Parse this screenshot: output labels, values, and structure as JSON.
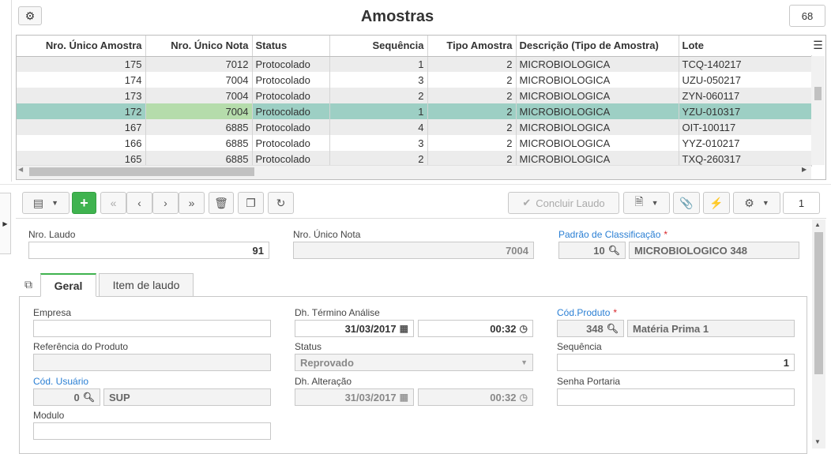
{
  "header": {
    "title": "Amostras",
    "record_count": "68"
  },
  "grid": {
    "columns": [
      "Nro. Único Amostra",
      "Nro. Único Nota",
      "Status",
      "Sequência",
      "Tipo Amostra",
      "Descrição (Tipo de Amostra)",
      "Lote"
    ],
    "rows": [
      {
        "amostra": "175",
        "nota": "7012",
        "status": "Protocolado",
        "seq": "1",
        "tipo": "2",
        "desc": "MICROBIOLOGICA",
        "lote": "TCQ-140217"
      },
      {
        "amostra": "174",
        "nota": "7004",
        "status": "Protocolado",
        "seq": "3",
        "tipo": "2",
        "desc": "MICROBIOLOGICA",
        "lote": "UZU-050217"
      },
      {
        "amostra": "173",
        "nota": "7004",
        "status": "Protocolado",
        "seq": "2",
        "tipo": "2",
        "desc": "MICROBIOLOGICA",
        "lote": "ZYN-060117"
      },
      {
        "amostra": "172",
        "nota": "7004",
        "status": "Protocolado",
        "seq": "1",
        "tipo": "2",
        "desc": "MICROBIOLOGICA",
        "lote": "YZU-010317"
      },
      {
        "amostra": "167",
        "nota": "6885",
        "status": "Protocolado",
        "seq": "4",
        "tipo": "2",
        "desc": "MICROBIOLOGICA",
        "lote": "OIT-100117"
      },
      {
        "amostra": "166",
        "nota": "6885",
        "status": "Protocolado",
        "seq": "3",
        "tipo": "2",
        "desc": "MICROBIOLOGICA",
        "lote": "YYZ-010217"
      },
      {
        "amostra": "165",
        "nota": "6885",
        "status": "Protocolado",
        "seq": "2",
        "tipo": "2",
        "desc": "MICROBIOLOGICA",
        "lote": "TXQ-260317"
      }
    ],
    "selected_index": 3
  },
  "toolbar": {
    "concluir_label": "Concluir Laudo",
    "page_number": "1"
  },
  "form": {
    "nro_laudo": {
      "label": "Nro. Laudo",
      "value": "91"
    },
    "nro_unico_nota": {
      "label": "Nro. Único Nota",
      "value": "7004"
    },
    "padrao": {
      "label": "Padrão de Classificação",
      "code": "10",
      "desc": "MICROBIOLOGICO 348"
    },
    "tabs": [
      "Geral",
      "Item de laudo"
    ],
    "empresa": {
      "label": "Empresa",
      "value": ""
    },
    "dh_termino": {
      "label": "Dh. Término Análise",
      "date": "31/03/2017",
      "time": "00:32"
    },
    "cod_produto": {
      "label": "Cód.Produto",
      "code": "348",
      "desc": "Matéria Prima 1"
    },
    "referencia": {
      "label": "Referência do Produto",
      "value": ""
    },
    "status": {
      "label": "Status",
      "value": "Reprovado"
    },
    "sequencia": {
      "label": "Sequência",
      "value": "1"
    },
    "cod_usuario": {
      "label": "Cód. Usuário",
      "code": "0",
      "desc": "SUP"
    },
    "dh_alteracao": {
      "label": "Dh. Alteração",
      "date": "31/03/2017",
      "time": "00:32"
    },
    "senha_portaria": {
      "label": "Senha Portaria",
      "value": ""
    },
    "modulo": {
      "label": "Modulo",
      "value": ""
    }
  }
}
